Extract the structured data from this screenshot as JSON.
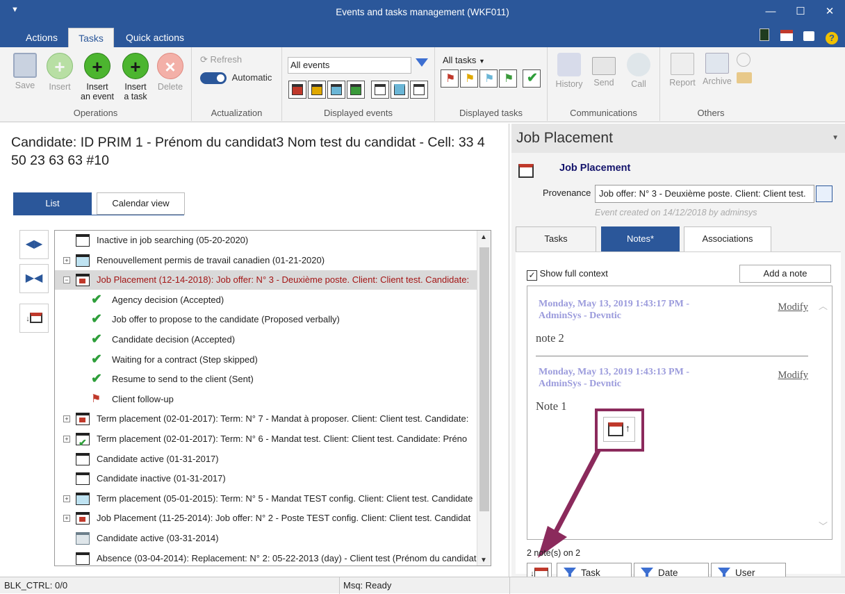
{
  "window": {
    "title": "Events and tasks management (WKF011)"
  },
  "ribbon_tabs": [
    "Actions",
    "Tasks",
    "Quick actions"
  ],
  "groups": {
    "operations": {
      "label": "Operations",
      "save": "Save",
      "insert": "Insert",
      "insert_event": [
        "Insert",
        "an event"
      ],
      "insert_task": [
        "Insert",
        "a task"
      ],
      "delete": "Delete"
    },
    "actualization": {
      "label": "Actualization",
      "refresh": "Refresh",
      "automatic": "Automatic"
    },
    "displayed_events": {
      "label": "Displayed events",
      "dropdown": "All events"
    },
    "displayed_tasks": {
      "label": "Displayed tasks",
      "dropdown": "All tasks"
    },
    "communications": {
      "label": "Communications",
      "history": "History",
      "send": "Send",
      "call": "Call"
    },
    "others": {
      "label": "Others",
      "report": "Report",
      "archive": "Archive"
    }
  },
  "candidate": {
    "title": "Candidate: ID PRIM 1 - Prénom du candidat3 Nom test du candidat - Cell: 33 4 50 23 63 63 #10"
  },
  "view_tabs": {
    "list": "List",
    "calendar": "Calendar view"
  },
  "tree": [
    {
      "text": "Inactive in job searching (05-20-2020)",
      "icon": "calendar-black",
      "level": 0,
      "expand": ""
    },
    {
      "text": "Renouvellement permis de travail canadien (01-21-2020)",
      "icon": "calendar-blue",
      "level": 0,
      "expand": "+"
    },
    {
      "text": "Job Placement (12-14-2018): Job offer: N° 3 - Deuxième poste.  Client: Client test.  Candidate:",
      "icon": "calendar-red",
      "level": 0,
      "expand": "−",
      "selected": true
    },
    {
      "text": "Agency decision (Accepted)",
      "icon": "check",
      "level": 1
    },
    {
      "text": "Job offer to propose to the candidate (Proposed verbally)",
      "icon": "check",
      "level": 1
    },
    {
      "text": "Candidate decision (Accepted)",
      "icon": "check",
      "level": 1
    },
    {
      "text": "Waiting for a contract (Step skipped)",
      "icon": "check",
      "level": 1
    },
    {
      "text": "Resume to send to the client (Sent)",
      "icon": "check",
      "level": 1
    },
    {
      "text": "Client follow-up",
      "icon": "flag",
      "level": 1
    },
    {
      "text": "Term placement (02-01-2017): Term: N° 7 - Mandat à proposer.  Client: Client test.  Candidate:",
      "icon": "calendar-red",
      "level": 0,
      "expand": "+"
    },
    {
      "text": "Term placement (02-01-2017): Term: N° 6 - Mandat test.  Client: Client test.  Candidate: Préno",
      "icon": "calendar-check",
      "level": 0,
      "expand": "+"
    },
    {
      "text": "Candidate active (01-31-2017)",
      "icon": "calendar-black",
      "level": 0,
      "expand": ""
    },
    {
      "text": "Candidate inactive (01-31-2017)",
      "icon": "calendar-black",
      "level": 0,
      "expand": ""
    },
    {
      "text": "Term placement (05-01-2015): Term: N° 5 - Mandat TEST config.  Client: Client test.  Candidate",
      "icon": "calendar-blue",
      "level": 0,
      "expand": "+"
    },
    {
      "text": "Job Placement (11-25-2014): Job offer: N° 2 - Poste TEST config.  Client: Client test.  Candidat",
      "icon": "calendar-red",
      "level": 0,
      "expand": "+"
    },
    {
      "text": "Candidate active (03-31-2014)",
      "icon": "calendar-gray",
      "level": 0,
      "expand": ""
    },
    {
      "text": "Absence (03-04-2014): Replacement: N° 2: 05-22-2013 (day) - Client test (Prénom du candidat",
      "icon": "calendar-black",
      "level": 0,
      "expand": ""
    }
  ],
  "status": {
    "left": "BLK_CTRL: 0/0",
    "msg": "Msq: Ready"
  },
  "right_panel": {
    "header": "Job Placement",
    "title": "Job Placement",
    "provenance_label": "Provenance",
    "provenance_value": "Job offer: N° 3 - Deuxième poste.  Client: Client test.",
    "created": "Event created on 14/12/2018 by adminsys",
    "tabs": {
      "tasks": "Tasks",
      "notes": "Notes*",
      "associations": "Associations"
    },
    "show_full_context": "Show full context",
    "add_note": "Add a note",
    "notes": [
      {
        "date": "Monday, May 13, 2019 1:43:17 PM -",
        "author": "AdminSys - Devntic",
        "modify": "Modify",
        "body": "note 2"
      },
      {
        "date": "Monday, May 13, 2019 1:43:13 PM -",
        "author": "AdminSys - Devntic",
        "modify": "Modify",
        "body": "Note 1"
      }
    ],
    "count": "2 note(s) on 2",
    "filters": {
      "task": "Task",
      "date": "Date",
      "user": "User"
    }
  },
  "colors": {
    "accent": "#2b579a",
    "highlight": "#8b2a5c"
  }
}
